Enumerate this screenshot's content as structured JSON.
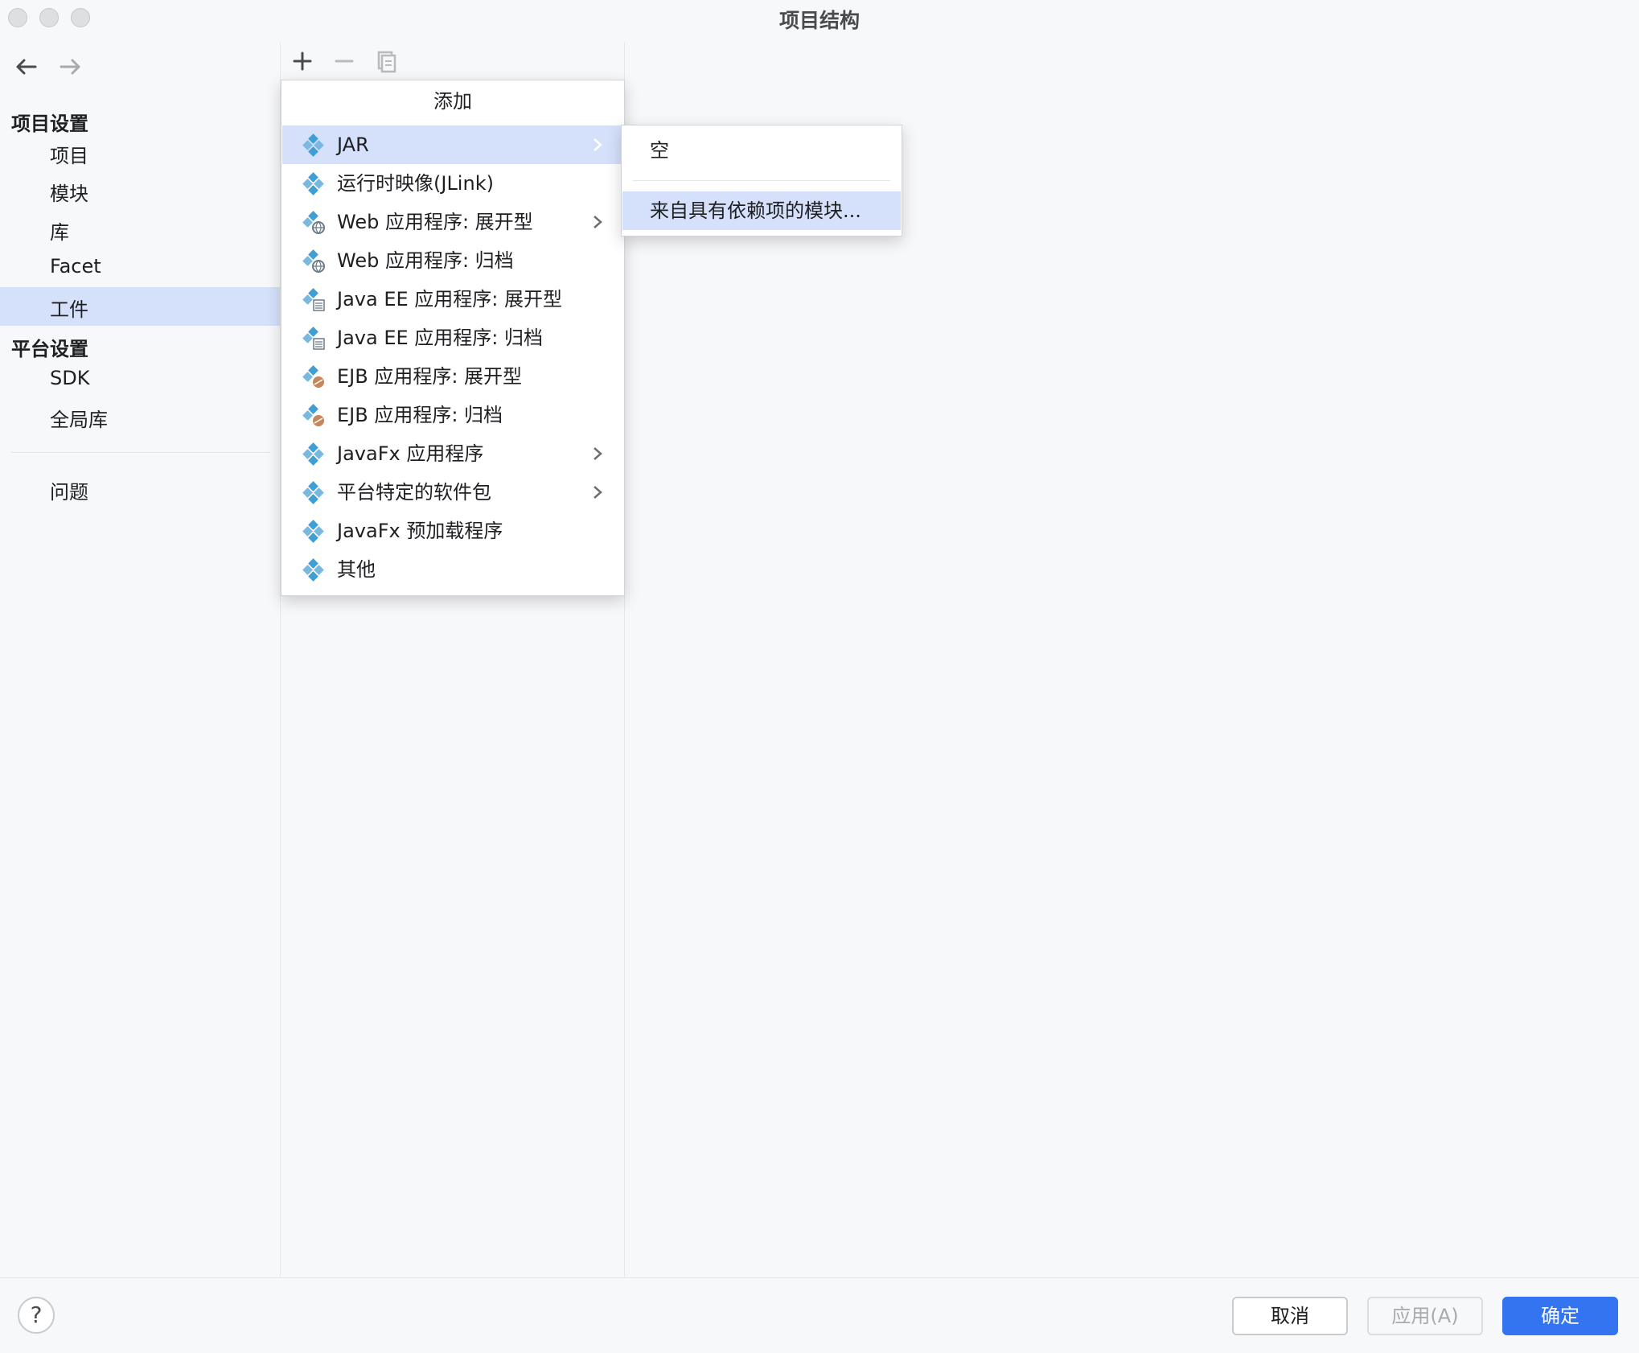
{
  "window": {
    "title": "项目结构"
  },
  "sidebar": {
    "project_settings_title": "项目设置",
    "project_items": [
      "项目",
      "模块",
      "库",
      "Facet",
      "工件"
    ],
    "platform_settings_title": "平台设置",
    "platform_items": [
      "SDK",
      "全局库"
    ],
    "problems_label": "问题",
    "selected": "工件"
  },
  "toolbar": {
    "add_icon": "plus-icon",
    "remove_icon": "minus-icon",
    "copy_icon": "copy-icon"
  },
  "popup": {
    "title": "添加",
    "items": [
      {
        "label": "JAR",
        "icon": "artifact-icon",
        "has_submenu": true
      },
      {
        "label": "运行时映像(JLink)",
        "icon": "artifact-icon",
        "has_submenu": false
      },
      {
        "label": "Web 应用程序: 展开型",
        "icon": "web-artifact-icon",
        "has_submenu": true
      },
      {
        "label": "Web 应用程序: 归档",
        "icon": "web-artifact-icon",
        "has_submenu": false
      },
      {
        "label": "Java EE 应用程序: 展开型",
        "icon": "javaee-artifact-icon",
        "has_submenu": false
      },
      {
        "label": "Java EE 应用程序: 归档",
        "icon": "javaee-artifact-icon",
        "has_submenu": false
      },
      {
        "label": "EJB 应用程序: 展开型",
        "icon": "ejb-artifact-icon",
        "has_submenu": false
      },
      {
        "label": "EJB 应用程序: 归档",
        "icon": "ejb-artifact-icon",
        "has_submenu": false
      },
      {
        "label": "JavaFx 应用程序",
        "icon": "artifact-icon",
        "has_submenu": true
      },
      {
        "label": "平台特定的软件包",
        "icon": "artifact-icon",
        "has_submenu": true
      },
      {
        "label": "JavaFx 预加载程序",
        "icon": "artifact-icon",
        "has_submenu": false
      },
      {
        "label": "其他",
        "icon": "artifact-icon",
        "has_submenu": false
      }
    ],
    "selected": "JAR"
  },
  "submenu": {
    "items": [
      "空",
      "来自具有依赖项的模块..."
    ],
    "selected": "来自具有依赖项的模块..."
  },
  "buttons": {
    "help": "?",
    "cancel": "取消",
    "apply": "应用(A)",
    "ok": "确定"
  },
  "colors": {
    "selection": "#d5e1fb",
    "primary_button": "#3574f0",
    "icon_blue": "#3d9fd8"
  }
}
